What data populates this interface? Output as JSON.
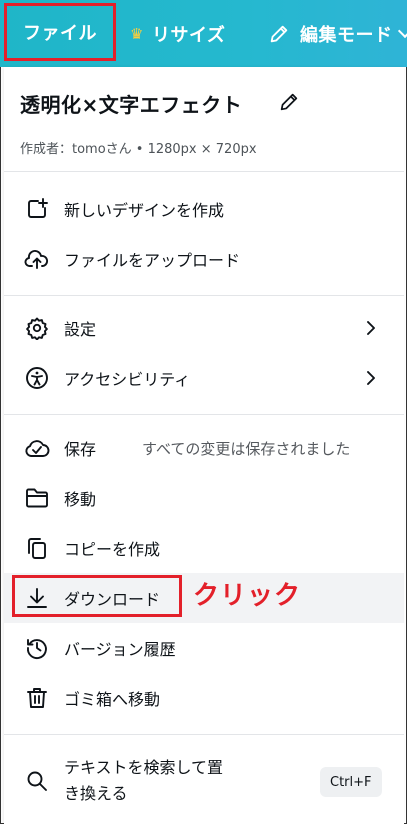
{
  "topbar": {
    "file_label": "ファイル",
    "resize_label": "リサイズ",
    "edit_label": "編集モード"
  },
  "menu": {
    "doc_title": "透明化×文字エフェクト",
    "doc_meta": "作成者：tomoさん • 1280px × 720px",
    "items": [
      {
        "label": "新しいデザインを作成",
        "icon": "new-design-icon"
      },
      {
        "label": "ファイルをアップロード",
        "icon": "cloud-upload-icon"
      },
      {
        "label": "設定",
        "icon": "gear-icon"
      },
      {
        "label": "アクセシビリティ",
        "icon": "accessibility-icon"
      },
      {
        "label": "保存",
        "icon": "cloud-check-icon",
        "aside": "すべての変更は保存されました"
      },
      {
        "label": "移動",
        "icon": "folder-icon"
      },
      {
        "label": "コピーを作成",
        "icon": "copy-icon"
      },
      {
        "label": "ダウンロード",
        "icon": "download-icon"
      },
      {
        "label": "バージョン履歴",
        "icon": "history-icon"
      },
      {
        "label": "ゴミ箱へ移動",
        "icon": "trash-icon"
      },
      {
        "label_line1": "テキストを検索して置",
        "label_line2": "き換える",
        "icon": "search-icon",
        "shortcut": "Ctrl+F"
      }
    ],
    "annotation": "クリック"
  },
  "colors": {
    "topbar": "#25b8cf",
    "highlight_border": "#e3202a",
    "crown": "#ffcf3a"
  }
}
